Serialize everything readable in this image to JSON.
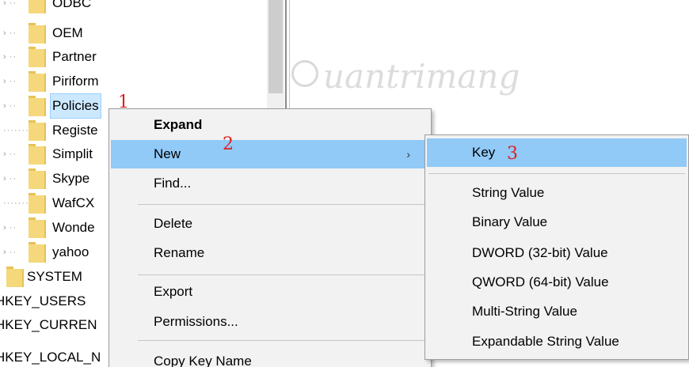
{
  "tree": {
    "items": [
      {
        "label": "ODBC"
      },
      {
        "label": "OEM"
      },
      {
        "label": "Partner"
      },
      {
        "label": "Piriform"
      },
      {
        "label": "Policies"
      },
      {
        "label": "Registe"
      },
      {
        "label": "Simplit"
      },
      {
        "label": "Skype"
      },
      {
        "label": "WafCX"
      },
      {
        "label": "Wonde"
      },
      {
        "label": "yahoo"
      },
      {
        "label": "SYSTEM"
      },
      {
        "label": "HKEY_USERS"
      },
      {
        "label": "HKEY_CURREN"
      },
      {
        "label": "HKEY_LOCAL_N"
      }
    ]
  },
  "watermark": {
    "text": "uantrimang"
  },
  "context_menu": {
    "items": [
      {
        "label": "Expand"
      },
      {
        "label": "New"
      },
      {
        "label": "Find..."
      },
      {
        "label": "Delete"
      },
      {
        "label": "Rename"
      },
      {
        "label": "Export"
      },
      {
        "label": "Permissions..."
      },
      {
        "label": "Copy Key Name"
      }
    ],
    "arrow": "›"
  },
  "submenu": {
    "items": [
      {
        "label": "Key"
      },
      {
        "label": "String Value"
      },
      {
        "label": "Binary Value"
      },
      {
        "label": "DWORD (32-bit) Value"
      },
      {
        "label": "QWORD (64-bit) Value"
      },
      {
        "label": "Multi-String Value"
      },
      {
        "label": "Expandable String Value"
      }
    ]
  },
  "steps": {
    "one": "1",
    "two": "2",
    "three": "3"
  },
  "colors": {
    "selection": "#cce8ff",
    "menu_highlight": "#91c9f7",
    "step_marker": "#e02020",
    "folder": "#f5d87c"
  }
}
